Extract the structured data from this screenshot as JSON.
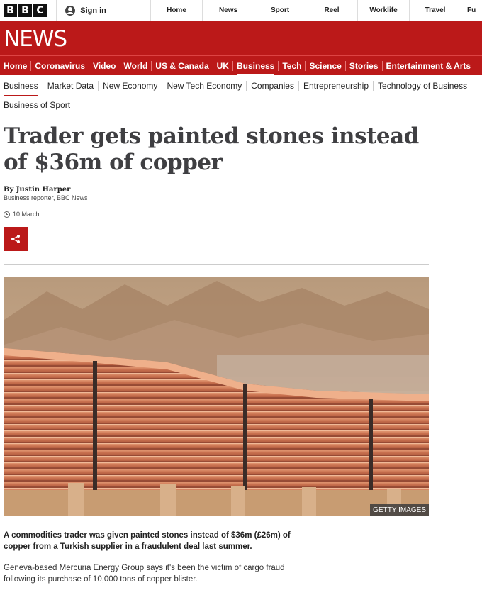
{
  "brand": {
    "logo_letters": [
      "B",
      "B",
      "C"
    ],
    "news_logo": "NEWS"
  },
  "top_bar": {
    "signin_label": "Sign in",
    "nav": [
      "Home",
      "News",
      "Sport",
      "Reel",
      "Worklife",
      "Travel",
      "Fu"
    ]
  },
  "section_nav": {
    "items": [
      "Home",
      "Coronavirus",
      "Video",
      "World",
      "US & Canada",
      "UK",
      "Business",
      "Tech",
      "Science",
      "Stories",
      "Entertainment & Arts"
    ],
    "active": "Business"
  },
  "sub_nav": {
    "items": [
      "Business",
      "Market Data",
      "New Economy",
      "New Tech Economy",
      "Companies",
      "Entrepreneurship",
      "Technology of Business"
    ],
    "second_row": "Business of Sport"
  },
  "article": {
    "headline": "Trader gets painted stones instead of $36m of copper",
    "author": "By Justin Harper",
    "author_role": "Business reporter, BBC News",
    "date": "10 March",
    "image_credit": "GETTY IMAGES",
    "intro": "A commodities trader was given painted stones instead of $36m (£26m) of copper from a Turkish supplier in a fraudulent deal last summer.",
    "body_first": "Geneva-based Mercuria Energy Group says it's been the victim of cargo fraud following its purchase of 10,000 tons of copper blister."
  },
  "colors": {
    "bbc_red": "#bb1919",
    "headline": "#3f3f42"
  },
  "icons": {
    "share": "share-icon",
    "clock": "clock-icon",
    "user": "user-icon"
  }
}
